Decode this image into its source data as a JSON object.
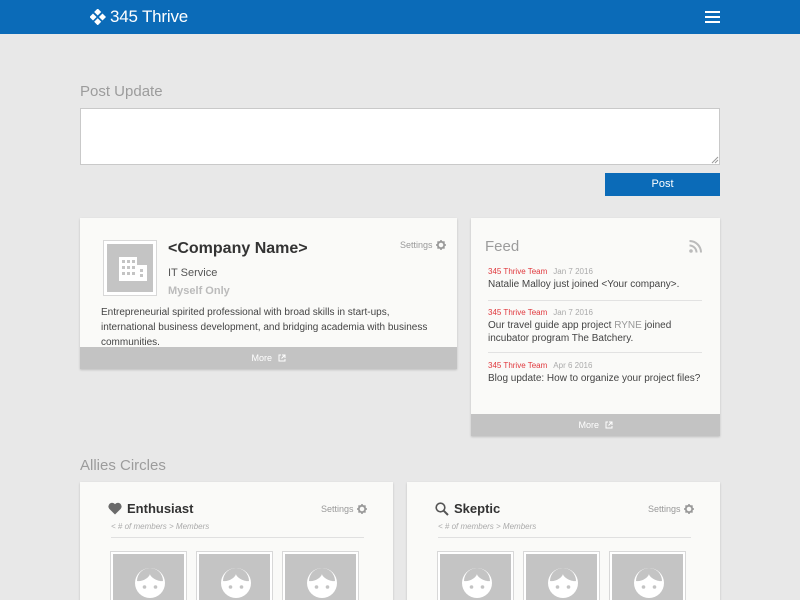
{
  "app": {
    "name": "345 Thrive"
  },
  "post_update": {
    "title": "Post Update",
    "textarea_value": "",
    "button_label": "Post"
  },
  "company": {
    "name": "<Company Name>",
    "type": "IT Service",
    "visibility": "Myself Only",
    "settings_label": "Settings",
    "description": "Entrepreneurial spirited professional with broad skills in start-ups, international business development, and bridging academia with business communities.",
    "more_label": "More"
  },
  "feed": {
    "title": "Feed",
    "more_label": "More",
    "items": [
      {
        "author": "345 Thrive Team",
        "date": "Jan 7 2016",
        "text": "Natalie Malloy just joined <Your company>."
      },
      {
        "author": "345 Thrive Team",
        "date": "Jan 7 2016",
        "text_before": "Our travel guide app project ",
        "text_highlight": "RYNE",
        "text_after": " joined incubator program The Batchery."
      },
      {
        "author": "345 Thrive Team",
        "date": "Apr 6 2016",
        "text": "Blog update: How to organize your project files?"
      }
    ]
  },
  "allies": {
    "title": "Allies Circles",
    "circles": [
      {
        "name": "Enthusiast",
        "icon": "heart-icon",
        "settings_label": "Settings",
        "members": "< # of members > Members"
      },
      {
        "name": "Skeptic",
        "icon": "search-icon",
        "settings_label": "Settings",
        "members": "< # of members > Members"
      }
    ]
  },
  "colors": {
    "brand": "#0b6bb8",
    "feed_author": "#e0393e",
    "background": "#e8e8e8"
  }
}
